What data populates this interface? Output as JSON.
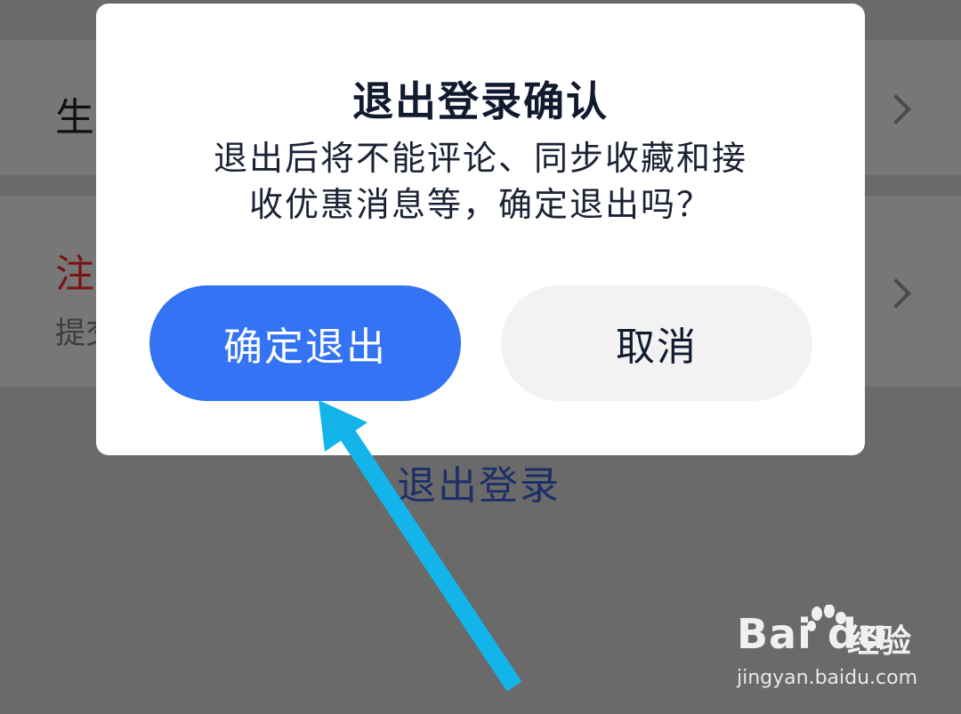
{
  "background": {
    "row1_title": "生",
    "row2_title": "注",
    "row2_subtitle": "提交",
    "logout_label": "退出登录"
  },
  "dialog": {
    "title": "退出登录确认",
    "message_line1": "退出后将不能评论、同步收藏和接",
    "message_line2": "收优惠消息等，确定退出吗？",
    "confirm_label": "确定退出",
    "cancel_label": "取消"
  },
  "watermark": {
    "logo_text": "Bai du",
    "cn_text": "经验",
    "url": "jingyan.baidu.com"
  },
  "colors": {
    "confirm_button": "#3473f3",
    "cancel_button": "#f2f2f2",
    "arrow": "#12b4ea",
    "overlay": "#6a6a6a"
  },
  "icons": [
    "chevron-right-icon",
    "arrow-annotation",
    "baidu-paw-icon"
  ]
}
